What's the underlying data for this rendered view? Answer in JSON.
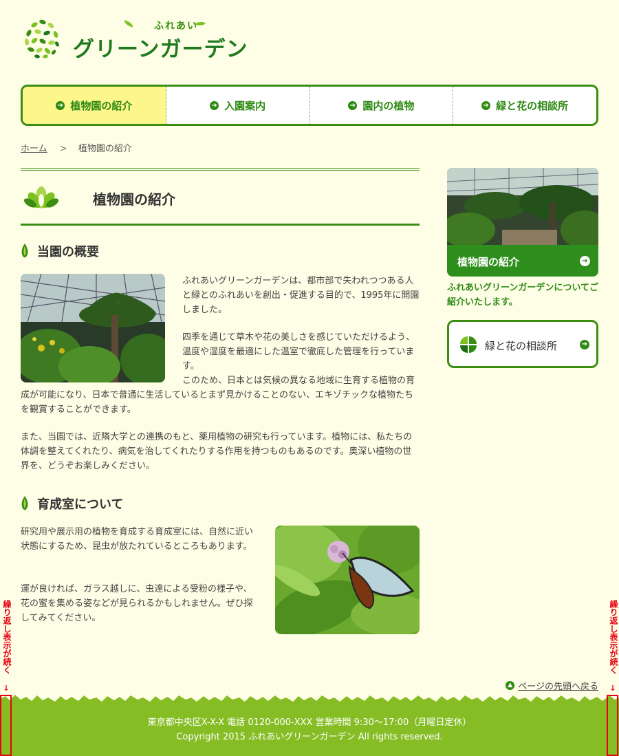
{
  "header": {
    "logo_sub": "ふれあい",
    "logo_main": "グリーンガーデン"
  },
  "nav": {
    "items": [
      {
        "label": "植物園の紹介",
        "active": true
      },
      {
        "label": "入園案内"
      },
      {
        "label": "園内の植物"
      },
      {
        "label": "緑と花の相談所"
      }
    ]
  },
  "breadcrumb": {
    "home": "ホーム",
    "separator": ">",
    "current": "植物園の紹介"
  },
  "main": {
    "title": "植物園の紹介",
    "section1": {
      "heading": "当園の概要",
      "p1": "ふれあいグリーンガーデンは、都市部で失われつつある人と緑とのふれあいを創出・促進する目的で、1995年に開園しました。",
      "p2a": "四季を通じて草木や花の美しさを感じていただけるよう、温度や湿度を最適にした温室で徹底した管理を行っています。",
      "p2b": "このため、日本とは気候の異なる地域に生育する植物の育成が可能になり、日本で普通に生活しているとまず見かけることのない、エキゾチックな植物たちを観賞することができます。",
      "p3": "また、当園では、近隣大学との連携のもと、薬用植物の研究も行っています。植物には、私たちの体調を整えてくれたり、病気を治してくれたりする作用を持つものもあるのです。奥深い植物の世界を、どうぞお楽しみください。"
    },
    "section2": {
      "heading": "育成室について",
      "p1": "研究用や展示用の植物を育成する育成室には、自然に近い状態にするため、昆虫が放たれているところもあります。",
      "p2": "運が良ければ、ガラス越しに、虫達による受粉の様子や、花の蜜を集める姿などが見られるかもしれません。ぜひ探してみてください。"
    }
  },
  "sidebar": {
    "card_label": "植物園の紹介",
    "card_desc": "ふれあいグリーンガーデンについてご紹介いたします。",
    "consult_label": "緑と花の相談所"
  },
  "pagetop": {
    "label": "ページの先頭へ戻る"
  },
  "footer": {
    "line1": "東京都中央区X-X-X 電話 0120-000-XXX 営業時間 9:30～17:00（月曜日定休）",
    "line2": "Copyright 2015 ふれあいグリーンガーデン All rights reserved."
  },
  "annotation": {
    "repeat_note": "繰り返し表示が続く"
  },
  "colors": {
    "background": "#fefee6",
    "primary_green": "#3a8d12",
    "nav_active": "#fdf78b",
    "footer_green": "#86bd25",
    "annotation_red": "#e60012"
  },
  "icons": {
    "nav_arrow": "arrow-right-circle-icon",
    "heading_marker": "leaf-drop-icon",
    "title_icon": "lotus-icon",
    "consult_icon": "clover-icon",
    "pagetop_icon": "arrow-up-circle-icon"
  }
}
